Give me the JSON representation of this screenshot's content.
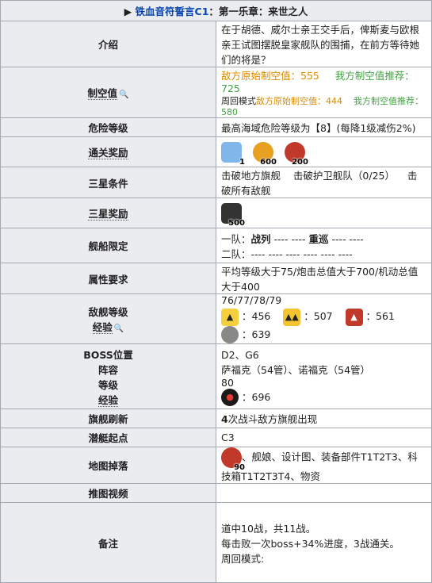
{
  "header": {
    "prefix": "▶ ",
    "stage_link": "铁血音符誓言C1",
    "stage_rest": "：第一乐章：来世之人"
  },
  "rows": {
    "intro": {
      "label": "介绍",
      "text": "在于胡德、威尔士亲王交手后，俾斯麦与欧根亲王试图摆脱皇家舰队的围捕，在前方等待她们的将是？"
    },
    "air": {
      "label": "制空值",
      "line1_a": "敌方原始制空值：555",
      "line1_b": "我方制空值推荐：725",
      "line2_prefix": "周回模式",
      "line2_a": "敌方原始制空值：444",
      "line2_b": "我方制空值推荐：580"
    },
    "danger": {
      "label": "危险等级",
      "text": "最高海域危险等级为【8】(每降1级减伤2%)"
    },
    "clear_reward": {
      "label": "通关奖励",
      "items": [
        {
          "icon": "cube-icon",
          "count": "1",
          "color": "#7fb8e8"
        },
        {
          "icon": "coin-icon",
          "count": "600",
          "color": "#e8a020"
        },
        {
          "icon": "oil-icon",
          "count": "200",
          "color": "#c0392b"
        }
      ]
    },
    "three_star": {
      "label": "三星条件",
      "c1": "击破地方旗舰",
      "c2": "击破护卫舰队（0/25）",
      "c3": "击破所有敌舰"
    },
    "three_star_reward": {
      "label": "三星奖励",
      "count": "500"
    },
    "ship_limit": {
      "label": "舰船限定",
      "fleet1_prefix": "一队：",
      "fleet1_a": "战列",
      "fleet1_mid": " ---- ---- ",
      "fleet1_b": "重巡",
      "fleet1_end": " ---- ----",
      "fleet2": "二队：---- ---- ---- ---- ---- ----"
    },
    "attr": {
      "label": "属性要求",
      "text": "平均等级大于75/炮击总值大于700/机动总值大于400"
    },
    "enemy": {
      "label1": "敌舰等级",
      "label2": "经验",
      "levels": "76/77/78/79",
      "exp": [
        {
          "icon": "small-fleet-icon",
          "value": "：456",
          "color": "#f4d03f"
        },
        {
          "icon": "medium-fleet-icon",
          "value": "：507",
          "color": "#f4c430"
        },
        {
          "icon": "large-fleet-icon",
          "value": "：561",
          "color": "#c0392b"
        },
        {
          "icon": "boss-fleet-icon",
          "value": "：639",
          "color": "#888888"
        }
      ]
    },
    "boss": {
      "label1": "BOSS位置",
      "label2": "阵容",
      "label3": "等级",
      "label4": "经验",
      "pos": "D2、G6",
      "lineup": "萨福克（54管）、诺福克（54管）",
      "level": "80",
      "exp": "：696"
    },
    "refresh": {
      "label": "旗舰刷新",
      "num": "4",
      "text": "次战斗敌方旗舰出现"
    },
    "sub": {
      "label": "潜艇起点",
      "text": "C3"
    },
    "drops": {
      "label": "地图掉落",
      "count": "90",
      "text": "、舰娘、设计图、装备部件T1T2T3、科技箱T1T2T3T4、物资"
    },
    "video": {
      "label": "推图视频",
      "text": ""
    },
    "notes": {
      "label": "备注",
      "line1": "道中10战，共11战。",
      "line2": "每击败一次boss+34%进度，3战通关。",
      "line3": "周回模式:"
    }
  }
}
